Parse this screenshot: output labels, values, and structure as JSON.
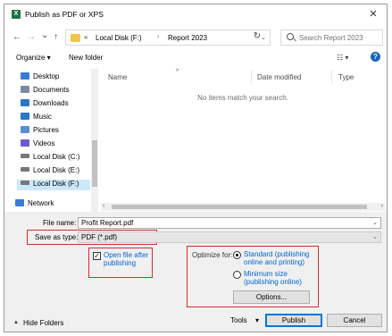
{
  "window": {
    "title": "Publish as PDF or XPS",
    "app_icon_letter": "X",
    "close_glyph": "✕"
  },
  "nav": {
    "back_glyph": "←",
    "forward_glyph": "→",
    "recent_glyph": "⌄",
    "up_glyph": "↑",
    "address": {
      "prefix": "«",
      "crumbs": [
        "Local Disk (F:)",
        "Report 2023"
      ],
      "separator": "›",
      "dropdown_glyph": "⌄"
    },
    "refresh_glyph": "↻",
    "search_placeholder": "Search Report 2023"
  },
  "toolbar": {
    "organize_label": "Organize ▾",
    "new_folder_label": "New folder",
    "view_glyph": "☷ ▾",
    "help_glyph": "?"
  },
  "sidebar": {
    "items": [
      {
        "label": "Desktop",
        "icon": "desktop-icon",
        "color": "#3a7bd5"
      },
      {
        "label": "Documents",
        "icon": "documents-icon",
        "color": "#7d8ba1"
      },
      {
        "label": "Downloads",
        "icon": "downloads-icon",
        "color": "#2b78c5"
      },
      {
        "label": "Music",
        "icon": "music-icon",
        "color": "#2b78c5"
      },
      {
        "label": "Pictures",
        "icon": "pictures-icon",
        "color": "#5b8fd1"
      },
      {
        "label": "Videos",
        "icon": "videos-icon",
        "color": "#6a5acd"
      },
      {
        "label": "Local Disk (C:)",
        "icon": "drive-icon",
        "color": "#777777"
      },
      {
        "label": "Local Disk (E:)",
        "icon": "drive-icon",
        "color": "#777777"
      },
      {
        "label": "Local Disk (F:)",
        "icon": "drive-icon",
        "color": "#777777"
      },
      {
        "label": "Network",
        "icon": "network-icon",
        "color": "#3a7bd5"
      }
    ],
    "selected": "Local Disk (F:)"
  },
  "filelist": {
    "columns": [
      "Name",
      "Date modified",
      "Type"
    ],
    "empty_message": "No items match your search.",
    "sort_glyph": "^"
  },
  "form": {
    "file_name_label": "File name:",
    "file_name_value": "Profit Report.pdf",
    "save_type_label": "Save as type:",
    "save_type_value": "PDF (*.pdf)",
    "open_after_publishing": {
      "label_line1": "Open file after",
      "label_line2": "publishing",
      "checked": true
    },
    "optimize_for_label": "Optimize for:",
    "options": [
      {
        "line1": "Standard (publishing",
        "line2": "online and printing)",
        "selected": true
      },
      {
        "line1": "Minimum size",
        "line2": "(publishing online)",
        "selected": false
      }
    ],
    "options_button": "Options...",
    "hide_folders": "Hide Folders",
    "hide_folders_glyph": "▲",
    "tools_label": "Tools",
    "tools_glyph": "▾",
    "publish_button": "Publish",
    "cancel_button": "Cancel"
  },
  "colors": {
    "highlight_border": "#d62b2b",
    "link": "#0066cc",
    "selected_item": "#cce8ff",
    "primary_border": "#0078d7"
  }
}
